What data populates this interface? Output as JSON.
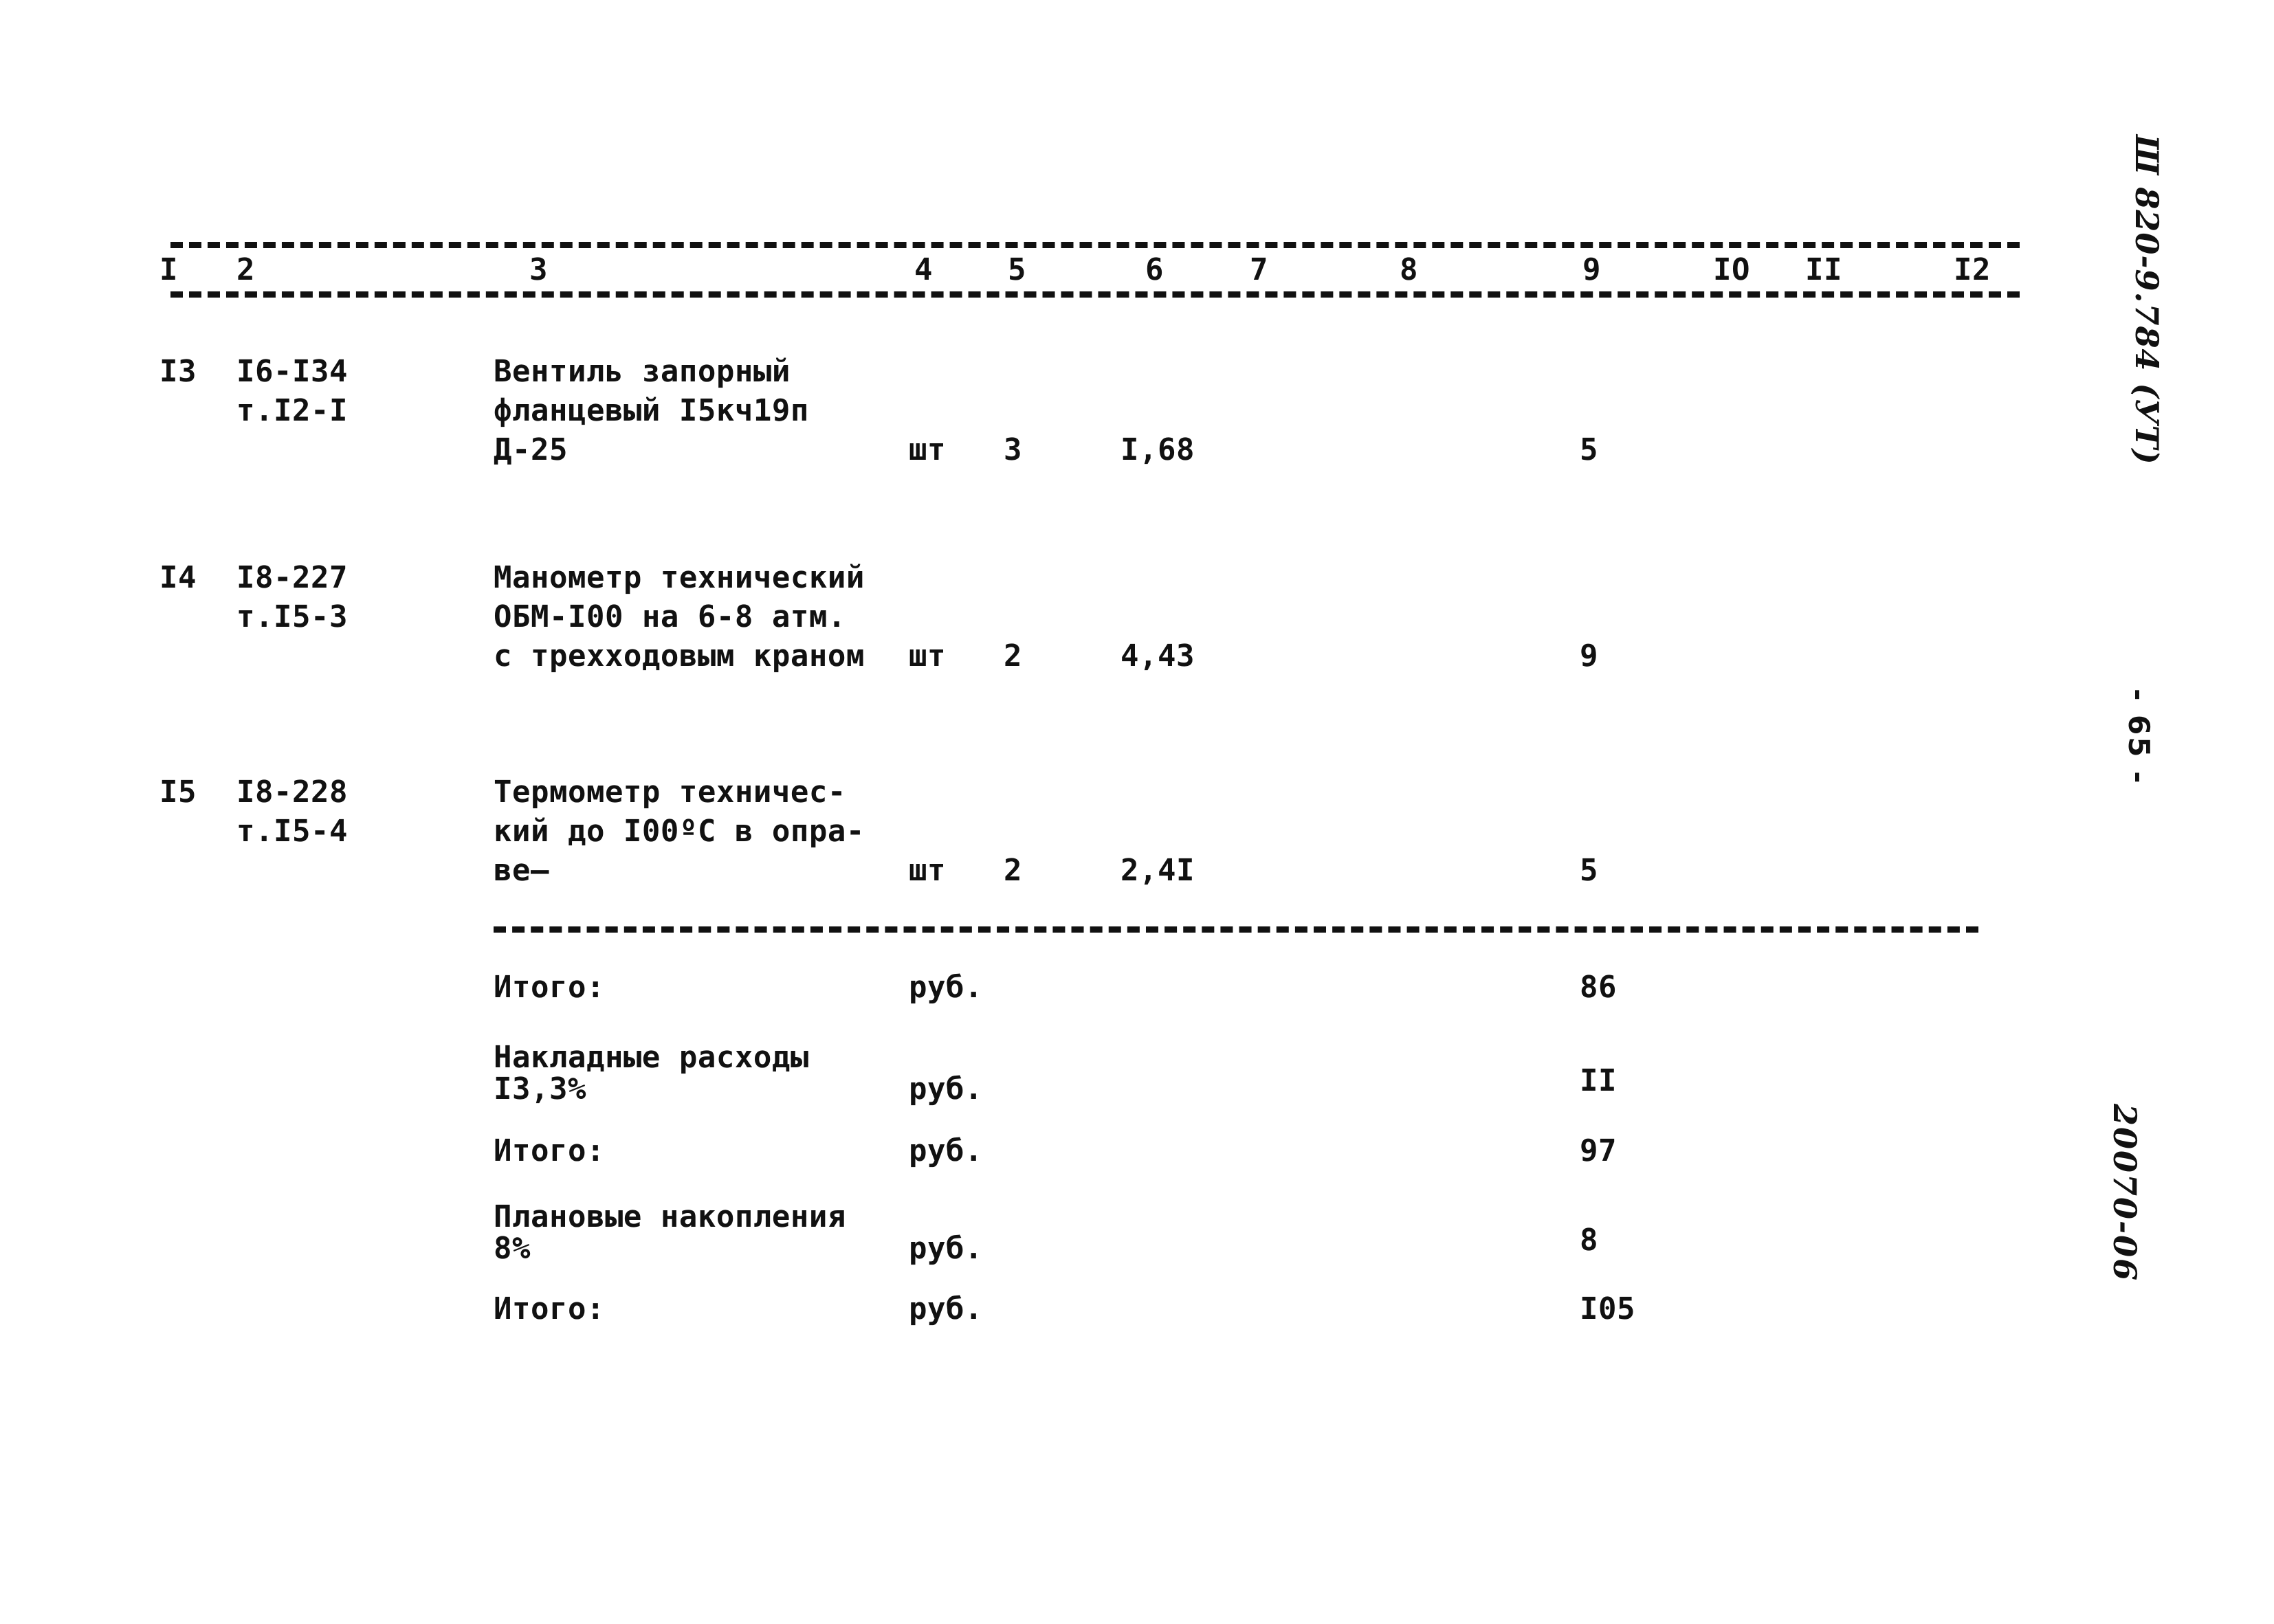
{
  "document": {
    "type": "scanned-estimate-table",
    "page_number_mark": "- 65 -",
    "margin_code_top": "Ш 820-9.784 (УТ)",
    "margin_code_bottom": "20070-06"
  },
  "table": {
    "column_numbers": [
      "I",
      "2",
      "3",
      "4",
      "5",
      "6",
      "7",
      "8",
      "9",
      "IO",
      "II",
      "I2"
    ],
    "rows": [
      {
        "pos": "I3",
        "code_line1": "I6-I34",
        "code_line2": "т.I2-I",
        "name_line1": "Вентиль запорный",
        "name_line2": "фланцевый I5кч19п",
        "name_line3": "Д-25",
        "unit": "шт",
        "qty": "3",
        "price": "I,68",
        "total": "5"
      },
      {
        "pos": "I4",
        "code_line1": "I8-227",
        "code_line2": "т.I5-3",
        "name_line1": "Манометр технический",
        "name_line2": "ОБМ-I00 на 6-8 атм.",
        "name_line3": "с трехходовым краном",
        "unit": "шт",
        "qty": "2",
        "price": "4,43",
        "total": "9"
      },
      {
        "pos": "I5",
        "code_line1": "I8-228",
        "code_line2": "т.I5-4",
        "name_line1": "Термометр техничес-",
        "name_line2": "кий до I00ºС в опра-",
        "name_line3": "ве—",
        "unit": "шт",
        "qty": "2",
        "price": "2,4I",
        "total": "5"
      }
    ]
  },
  "summary": {
    "rows": [
      {
        "label_line1": "Итого:",
        "label_line2": "",
        "unit": "руб.",
        "value": "86"
      },
      {
        "label_line1": "Накладные расходы",
        "label_line2": "I3,3%",
        "unit": "руб.",
        "value": "II"
      },
      {
        "label_line1": "Итого:",
        "label_line2": "",
        "unit": "руб.",
        "value": "97"
      },
      {
        "label_line1": "Плановые накопления",
        "label_line2": "8%",
        "unit": "руб.",
        "value": "8"
      },
      {
        "label_line1": "Итого:",
        "label_line2": "",
        "unit": "руб.",
        "value": "I05"
      }
    ]
  }
}
